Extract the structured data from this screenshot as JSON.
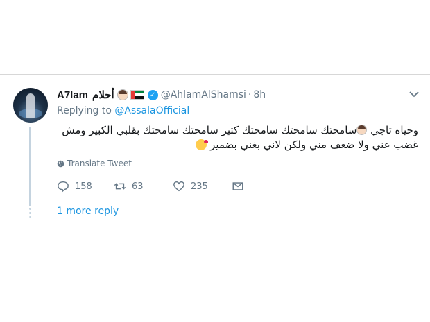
{
  "tweet": {
    "display_name": "A7lam",
    "display_name_arabic": "أحلام",
    "handle": "@AhlamAlShamsi",
    "separator": "·",
    "time": "8h",
    "replying_prefix": "Replying to",
    "replying_to": "@AssalaOfficial",
    "text_part1": "وحياه تاجي",
    "text_part2": "سامحتك سامحتك سامحتك كتير  سامحتك سامحتك بقلبي الكبير ومش غضب عني ولا ضعف مني ولكن لاني بغني بضمير",
    "translate_label": "Translate Tweet",
    "replies": "158",
    "retweets": "63",
    "likes": "235",
    "more_replies": "1 more reply"
  },
  "colors": {
    "accent": "#1b95e0",
    "verified": "#1da1f2",
    "muted": "#657786",
    "thread_line": "#c4d3df"
  },
  "icons": {
    "verified": "verified-badge-icon",
    "caret": "chevron-down-icon",
    "globe": "globe-icon",
    "reply": "reply-icon",
    "retweet": "retweet-icon",
    "like": "heart-icon",
    "dm": "envelope-icon"
  }
}
